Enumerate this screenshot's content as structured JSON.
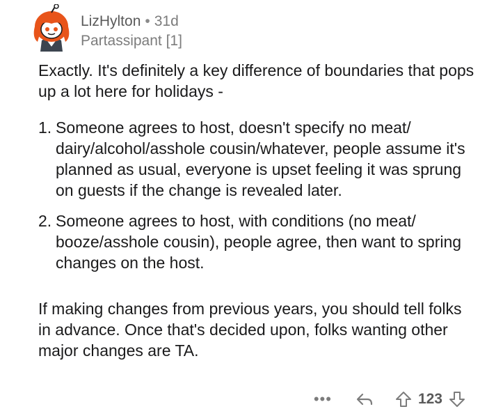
{
  "comment": {
    "author": "LizHylton",
    "age": "31d",
    "flair": "Partassipant [1]",
    "paragraph1": "Exactly. It's definitely a key difference of boundaries that pops up a lot here for holidays -",
    "list_items": [
      {
        "num": "1.",
        "text": "Someone agrees to host, doesn't specify no meat/ dairy/alcohol/asshole cousin/whatever, people assume it's planned as usual, everyone is upset feeling it was sprung on guests if the change is revealed later."
      },
      {
        "num": "2.",
        "text": "Someone agrees to host, with conditions (no meat/ booze/asshole cousin), people agree, then want to spring changes on the host."
      }
    ],
    "paragraph2": "If making changes from previous years, you should tell folks in advance. Once that's decided upon, folks wanting other major changes are TA."
  },
  "actions": {
    "more_label": "•••",
    "score": "123",
    "icons": [
      "more-icon",
      "reply-icon",
      "upvote-icon",
      "downvote-icon"
    ]
  },
  "colors": {
    "text": "#1a1a1b",
    "meta": "#7c7c7c",
    "avatar_hair": "#e8541a"
  }
}
